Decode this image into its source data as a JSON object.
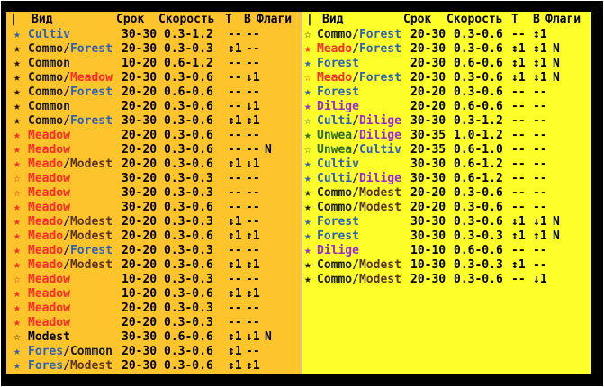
{
  "colors": {
    "left_bg": "#fec42c",
    "right_bg": "#fefe2a",
    "Forest": "#2e62b6",
    "Meadow": "#ff2a2a",
    "Modest": "#5a3418",
    "Commo": "#1a1a1a",
    "Common": "#1a1a1a",
    "Cultiv": "#2e62b6",
    "Dilige": "#9a2ad6",
    "Unwea": "#2a6a1e",
    "Culti": "#2e62b6",
    "Fores": "#2e62b6",
    "Meado": "#ff2a2a",
    "Modest_single": "#000000"
  },
  "headers": {
    "marker": "|",
    "name": "Вид",
    "term": "Срок",
    "speed": "Скорость",
    "t": "T",
    "v": "В",
    "flags": "Флаги"
  },
  "left_rows": [
    {
      "star": "★",
      "starColor": "#2e62b6",
      "parts": [
        [
          "Cultiv",
          "#2e62b6"
        ]
      ],
      "term": "30-30",
      "speed": "0.3-1.2",
      "t": "--",
      "v": "--",
      "flags": ""
    },
    {
      "star": "★",
      "starColor": "#1a1a1a",
      "parts": [
        [
          "Commo",
          "#1a1a1a"
        ],
        [
          "/",
          "#1a1a1a"
        ],
        [
          "Forest",
          "#2e62b6"
        ]
      ],
      "term": "20-30",
      "speed": "0.3-0.3",
      "t": "↕1",
      "v": "--",
      "flags": ""
    },
    {
      "star": "★",
      "starColor": "#1a1a1a",
      "parts": [
        [
          "Common",
          "#1a1a1a"
        ]
      ],
      "term": "10-20",
      "speed": "0.6-1.2",
      "t": "--",
      "v": "--",
      "flags": ""
    },
    {
      "star": "★",
      "starColor": "#1a1a1a",
      "parts": [
        [
          "Commo",
          "#1a1a1a"
        ],
        [
          "/",
          "#1a1a1a"
        ],
        [
          "Meadow",
          "#ff2a2a"
        ]
      ],
      "term": "20-30",
      "speed": "0.3-0.6",
      "t": "--",
      "v": "↓1",
      "flags": ""
    },
    {
      "star": "★",
      "starColor": "#1a1a1a",
      "parts": [
        [
          "Commo",
          "#1a1a1a"
        ],
        [
          "/",
          "#1a1a1a"
        ],
        [
          "Forest",
          "#2e62b6"
        ]
      ],
      "term": "20-20",
      "speed": "0.6-0.6",
      "t": "--",
      "v": "--",
      "flags": ""
    },
    {
      "star": "★",
      "starColor": "#1a1a1a",
      "parts": [
        [
          "Common",
          "#1a1a1a"
        ]
      ],
      "term": "20-20",
      "speed": "0.3-0.6",
      "t": "--",
      "v": "↓1",
      "flags": ""
    },
    {
      "star": "★",
      "starColor": "#1a1a1a",
      "parts": [
        [
          "Commo",
          "#1a1a1a"
        ],
        [
          "/",
          "#1a1a1a"
        ],
        [
          "Forest",
          "#2e62b6"
        ]
      ],
      "term": "30-30",
      "speed": "0.3-0.6",
      "t": "↕1",
      "v": "↕1",
      "flags": ""
    },
    {
      "star": "★",
      "starColor": "#ff2a2a",
      "parts": [
        [
          "Meadow",
          "#ff2a2a"
        ]
      ],
      "term": "20-20",
      "speed": "0.3-0.6",
      "t": "--",
      "v": "--",
      "flags": ""
    },
    {
      "star": "★",
      "starColor": "#ff2a2a",
      "parts": [
        [
          "Meadow",
          "#ff2a2a"
        ]
      ],
      "term": "20-20",
      "speed": "0.3-0.6",
      "t": "--",
      "v": "--",
      "flags": "N"
    },
    {
      "star": "★",
      "starColor": "#ff2a2a",
      "parts": [
        [
          "Meado",
          "#ff2a2a"
        ],
        [
          "/",
          "#1a1a1a"
        ],
        [
          "Modest",
          "#5a3418"
        ]
      ],
      "term": "20-20",
      "speed": "0.3-0.6",
      "t": "↕1",
      "v": "↓1",
      "flags": ""
    },
    {
      "star": "☆",
      "starColor": "#ff2a2a",
      "parts": [
        [
          "Meadow",
          "#ff2a2a"
        ]
      ],
      "term": "30-20",
      "speed": "0.3-0.3",
      "t": "--",
      "v": "--",
      "flags": ""
    },
    {
      "star": "☆",
      "starColor": "#ff2a2a",
      "parts": [
        [
          "Meadow",
          "#ff2a2a"
        ]
      ],
      "term": "30-20",
      "speed": "0.3-0.3",
      "t": "--",
      "v": "--",
      "flags": ""
    },
    {
      "star": "★",
      "starColor": "#ff2a2a",
      "parts": [
        [
          "Meadow",
          "#ff2a2a"
        ]
      ],
      "term": "30-20",
      "speed": "0.3-0.6",
      "t": "--",
      "v": "--",
      "flags": ""
    },
    {
      "star": "★",
      "starColor": "#ff2a2a",
      "parts": [
        [
          "Meado",
          "#ff2a2a"
        ],
        [
          "/",
          "#1a1a1a"
        ],
        [
          "Modest",
          "#5a3418"
        ]
      ],
      "term": "20-20",
      "speed": "0.3-0.3",
      "t": "↕1",
      "v": "--",
      "flags": ""
    },
    {
      "star": "★",
      "starColor": "#ff2a2a",
      "parts": [
        [
          "Meado",
          "#ff2a2a"
        ],
        [
          "/",
          "#1a1a1a"
        ],
        [
          "Modest",
          "#5a3418"
        ]
      ],
      "term": "20-20",
      "speed": "0.3-0.6",
      "t": "↕1",
      "v": "↕1",
      "flags": ""
    },
    {
      "star": "★",
      "starColor": "#ff2a2a",
      "parts": [
        [
          "Meado",
          "#ff2a2a"
        ],
        [
          "/",
          "#1a1a1a"
        ],
        [
          "Forest",
          "#2e62b6"
        ]
      ],
      "term": "20-20",
      "speed": "0.3-0.3",
      "t": "--",
      "v": "--",
      "flags": ""
    },
    {
      "star": "★",
      "starColor": "#ff2a2a",
      "parts": [
        [
          "Meado",
          "#ff2a2a"
        ],
        [
          "/",
          "#1a1a1a"
        ],
        [
          "Modest",
          "#5a3418"
        ]
      ],
      "term": "20-20",
      "speed": "0.3-0.6",
      "t": "↕1",
      "v": "↕1",
      "flags": ""
    },
    {
      "star": "☆",
      "starColor": "#ff2a2a",
      "parts": [
        [
          "Meadow",
          "#ff2a2a"
        ]
      ],
      "term": "10-20",
      "speed": "0.3-0.3",
      "t": "--",
      "v": "--",
      "flags": ""
    },
    {
      "star": "★",
      "starColor": "#ff2a2a",
      "parts": [
        [
          "Meadow",
          "#ff2a2a"
        ]
      ],
      "term": "10-20",
      "speed": "0.3-0.6",
      "t": "↕1",
      "v": "↕1",
      "flags": ""
    },
    {
      "star": "★",
      "starColor": "#ff2a2a",
      "parts": [
        [
          "Meadow",
          "#ff2a2a"
        ]
      ],
      "term": "20-20",
      "speed": "0.3-0.3",
      "t": "--",
      "v": "--",
      "flags": ""
    },
    {
      "star": "★",
      "starColor": "#ff2a2a",
      "parts": [
        [
          "Meadow",
          "#ff2a2a"
        ]
      ],
      "term": "20-20",
      "speed": "0.3-0.3",
      "t": "--",
      "v": "--",
      "flags": ""
    },
    {
      "star": "☆",
      "starColor": "#000000",
      "parts": [
        [
          "Modest",
          "#000000"
        ]
      ],
      "term": "30-30",
      "speed": "0.6-0.6",
      "t": "↕1",
      "v": "↓1",
      "flags": "N"
    },
    {
      "star": "★",
      "starColor": "#2e62b6",
      "parts": [
        [
          "Fores",
          "#2e62b6"
        ],
        [
          "/",
          "#1a1a1a"
        ],
        [
          "Common",
          "#1a1a1a"
        ]
      ],
      "term": "20-30",
      "speed": "0.3-0.6",
      "t": "↕1",
      "v": "--",
      "flags": ""
    },
    {
      "star": "★",
      "starColor": "#2e62b6",
      "parts": [
        [
          "Fores",
          "#2e62b6"
        ],
        [
          "/",
          "#1a1a1a"
        ],
        [
          "Modest",
          "#5a3418"
        ]
      ],
      "term": "20-30",
      "speed": "0.3-0.6",
      "t": "↕1",
      "v": "↕1",
      "flags": ""
    }
  ],
  "right_rows": [
    {
      "star": "☆",
      "starColor": "#1a1a1a",
      "parts": [
        [
          "Commo",
          "#1a1a1a"
        ],
        [
          "/",
          "#1a1a1a"
        ],
        [
          "Forest",
          "#2e62b6"
        ]
      ],
      "term": "20-30",
      "speed": "0.3-0.6",
      "t": "--",
      "v": "↕1",
      "flags": ""
    },
    {
      "star": "★",
      "starColor": "#ff2a2a",
      "parts": [
        [
          "Meado",
          "#ff2a2a"
        ],
        [
          "/",
          "#1a1a1a"
        ],
        [
          "Forest",
          "#2e62b6"
        ]
      ],
      "term": "20-30",
      "speed": "0.3-0.6",
      "t": "↕1",
      "v": "↕1",
      "flags": "N"
    },
    {
      "star": "★",
      "starColor": "#2e62b6",
      "parts": [
        [
          "Forest",
          "#2e62b6"
        ]
      ],
      "term": "20-30",
      "speed": "0.6-0.6",
      "t": "↕1",
      "v": "↕1",
      "flags": "N"
    },
    {
      "star": "☆",
      "starColor": "#ff2a2a",
      "parts": [
        [
          "Meado",
          "#ff2a2a"
        ],
        [
          "/",
          "#1a1a1a"
        ],
        [
          "Forest",
          "#2e62b6"
        ]
      ],
      "term": "20-30",
      "speed": "0.3-0.6",
      "t": "↕1",
      "v": "↕1",
      "flags": "N"
    },
    {
      "star": "★",
      "starColor": "#2e62b6",
      "parts": [
        [
          "Forest",
          "#2e62b6"
        ]
      ],
      "term": "20-20",
      "speed": "0.3-0.6",
      "t": "--",
      "v": "--",
      "flags": ""
    },
    {
      "star": "★",
      "starColor": "#9a2ad6",
      "parts": [
        [
          "Dilige",
          "#9a2ad6"
        ]
      ],
      "term": "20-20",
      "speed": "0.6-0.6",
      "t": "--",
      "v": "--",
      "flags": ""
    },
    {
      "star": "☆",
      "starColor": "#2e62b6",
      "parts": [
        [
          "Culti",
          "#2e62b6"
        ],
        [
          "/",
          "#1a1a1a"
        ],
        [
          "Dilige",
          "#9a2ad6"
        ]
      ],
      "term": "30-30",
      "speed": "0.3-1.2",
      "t": "--",
      "v": "--",
      "flags": ""
    },
    {
      "star": "★",
      "starColor": "#2a6a1e",
      "parts": [
        [
          "Unwea",
          "#2a6a1e"
        ],
        [
          "/",
          "#1a1a1a"
        ],
        [
          "Dilige",
          "#9a2ad6"
        ]
      ],
      "term": "30-35",
      "speed": "1.0-1.2",
      "t": "--",
      "v": "--",
      "flags": ""
    },
    {
      "star": "☆",
      "starColor": "#2a6a1e",
      "parts": [
        [
          "Unwea",
          "#2a6a1e"
        ],
        [
          "/",
          "#1a1a1a"
        ],
        [
          "Cultiv",
          "#2e62b6"
        ]
      ],
      "term": "20-35",
      "speed": "0.6-1.0",
      "t": "--",
      "v": "--",
      "flags": ""
    },
    {
      "star": "★",
      "starColor": "#2e62b6",
      "parts": [
        [
          "Cultiv",
          "#2e62b6"
        ]
      ],
      "term": "30-30",
      "speed": "0.6-1.2",
      "t": "--",
      "v": "--",
      "flags": ""
    },
    {
      "star": "★",
      "starColor": "#2e62b6",
      "parts": [
        [
          "Culti",
          "#2e62b6"
        ],
        [
          "/",
          "#1a1a1a"
        ],
        [
          "Dilige",
          "#9a2ad6"
        ]
      ],
      "term": "30-30",
      "speed": "0.6-1.2",
      "t": "--",
      "v": "--",
      "flags": ""
    },
    {
      "star": "★",
      "starColor": "#1a1a1a",
      "parts": [
        [
          "Commo",
          "#1a1a1a"
        ],
        [
          "/",
          "#1a1a1a"
        ],
        [
          "Modest",
          "#5a3418"
        ]
      ],
      "term": "20-20",
      "speed": "0.3-0.6",
      "t": "--",
      "v": "--",
      "flags": ""
    },
    {
      "star": "★",
      "starColor": "#1a1a1a",
      "parts": [
        [
          "Commo",
          "#1a1a1a"
        ],
        [
          "/",
          "#1a1a1a"
        ],
        [
          "Modest",
          "#5a3418"
        ]
      ],
      "term": "20-20",
      "speed": "0.3-0.6",
      "t": "--",
      "v": "--",
      "flags": ""
    },
    {
      "star": "★",
      "starColor": "#2e62b6",
      "parts": [
        [
          "Forest",
          "#2e62b6"
        ]
      ],
      "term": "30-30",
      "speed": "0.3-0.6",
      "t": "↕1",
      "v": "↓1",
      "flags": "N"
    },
    {
      "star": "★",
      "starColor": "#2e62b6",
      "parts": [
        [
          "Forest",
          "#2e62b6"
        ]
      ],
      "term": "30-30",
      "speed": "0.3-0.3",
      "t": "↕1",
      "v": "↕1",
      "flags": "N"
    },
    {
      "star": "★",
      "starColor": "#9a2ad6",
      "parts": [
        [
          "Dilige",
          "#9a2ad6"
        ]
      ],
      "term": "10-10",
      "speed": "0.6-0.6",
      "t": "--",
      "v": "--",
      "flags": ""
    },
    {
      "star": "★",
      "starColor": "#1a1a1a",
      "parts": [
        [
          "Commo",
          "#1a1a1a"
        ],
        [
          "/",
          "#1a1a1a"
        ],
        [
          "Modest",
          "#5a3418"
        ]
      ],
      "term": "10-30",
      "speed": "0.3-0.3",
      "t": "↕1",
      "v": "--",
      "flags": ""
    },
    {
      "star": "★",
      "starColor": "#1a1a1a",
      "parts": [
        [
          "Commo",
          "#1a1a1a"
        ],
        [
          "/",
          "#1a1a1a"
        ],
        [
          "Modest",
          "#5a3418"
        ]
      ],
      "term": "20-30",
      "speed": "0.3-0.6",
      "t": "--",
      "v": "↓1",
      "flags": ""
    }
  ]
}
